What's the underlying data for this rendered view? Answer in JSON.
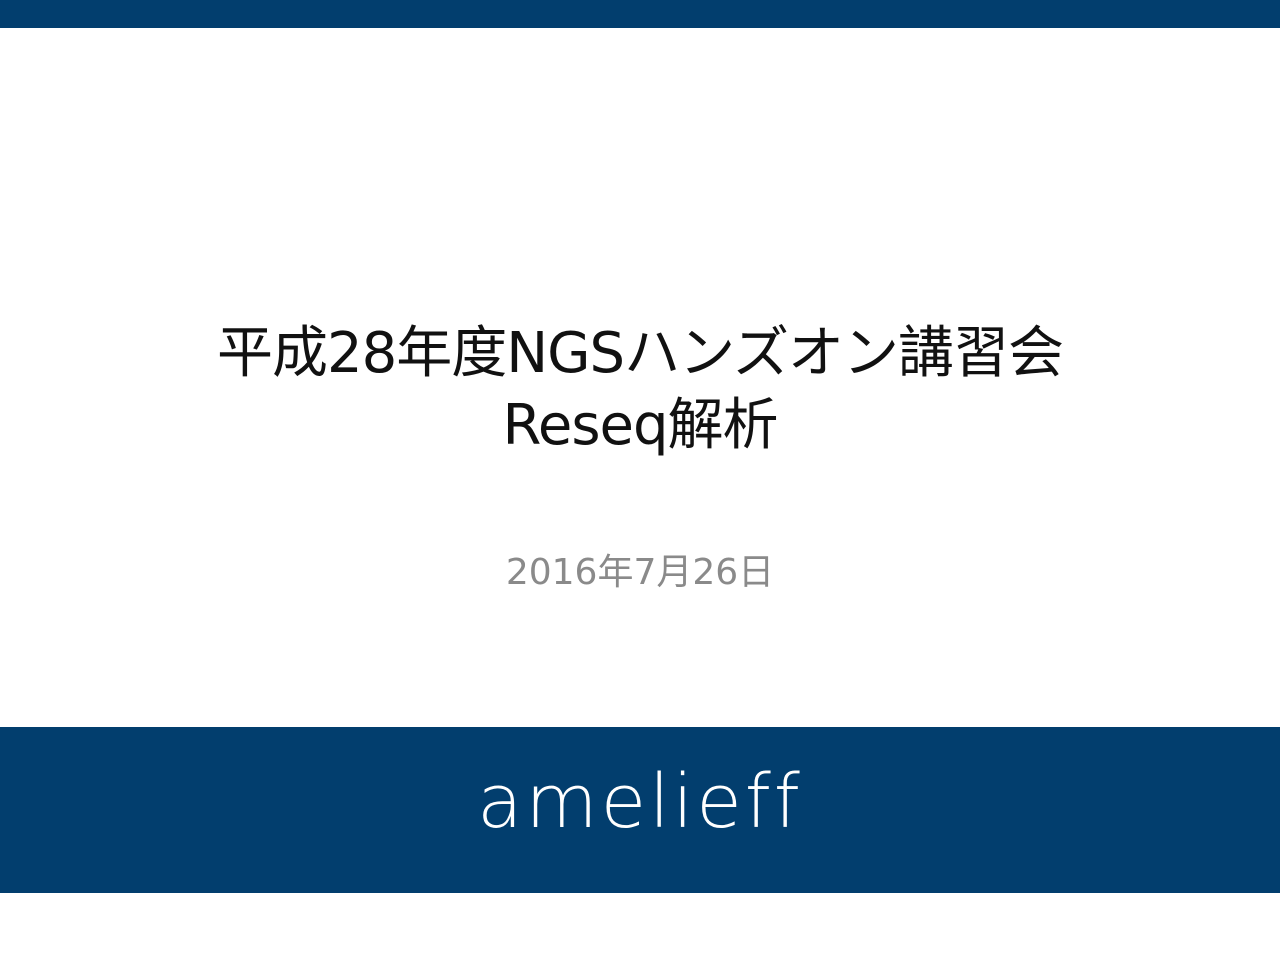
{
  "slide": {
    "title_line1": "平成28年度NGSハンズオン講習会",
    "title_line2": "Reseq解析",
    "date": "2016年7月26日",
    "logo_text": "amelieff"
  },
  "colors": {
    "brand_navy": "#023e6e",
    "title_text": "#111111",
    "date_text": "#8a8a8a",
    "logo_text": "#ffffff"
  }
}
